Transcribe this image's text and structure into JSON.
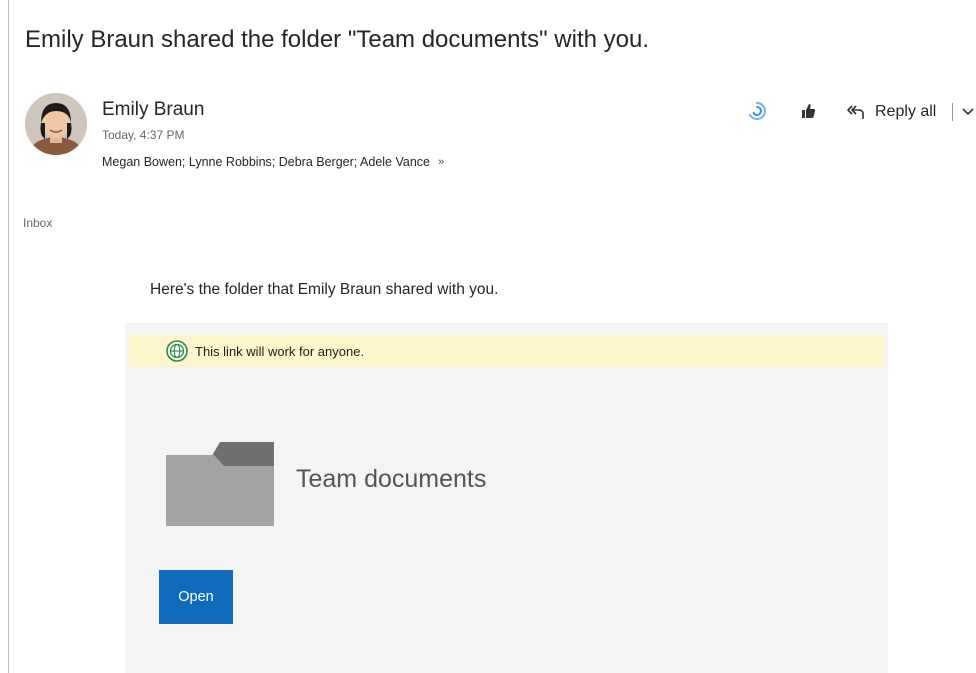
{
  "email": {
    "subject": "Emily Braun shared the folder \"Team documents\" with you.",
    "sender": {
      "name": "Emily Braun",
      "timestamp": "Today, 4:37 PM"
    },
    "recipients": "Megan Bowen; Lynne Robbins; Debra Berger; Adele Vance",
    "folder": "Inbox",
    "actions": {
      "reply_all_label": "Reply all"
    }
  },
  "body": {
    "intro": "Here's the folder that Emily Braun shared with you.",
    "banner_text": "This link will work for anyone.",
    "shared_folder_name": "Team documents",
    "open_button_label": "Open"
  },
  "icons": {
    "reaction": "reaction-icon",
    "like": "like-icon",
    "reply_all": "reply-all-icon",
    "dropdown": "chevron-down-icon",
    "expand_recipients": "double-chevron-down-icon",
    "globe": "globe-icon",
    "folder": "folder-icon"
  },
  "colors": {
    "accent": "#0f6cbd",
    "banner_bg": "#fdf5cc",
    "card_bg": "#f4f4f4",
    "globe_green": "#2e8b3d"
  }
}
